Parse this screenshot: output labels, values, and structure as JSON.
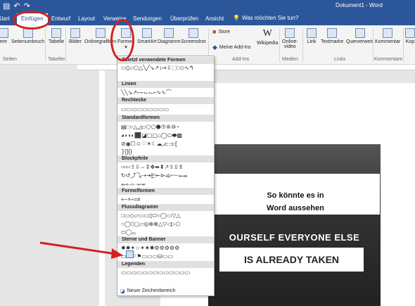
{
  "titlebar": {
    "title": "Dokument1 - Word",
    "undo": "↶",
    "redo": "↷",
    "save": "▤"
  },
  "tabs": [
    {
      "label": "Start"
    },
    {
      "label": "Einfügen"
    },
    {
      "label": "Entwurf"
    },
    {
      "label": "Layout"
    },
    {
      "label": "Verweise"
    },
    {
      "label": "Sendungen"
    },
    {
      "label": "Überprüfen"
    },
    {
      "label": "Ansicht"
    }
  ],
  "tellme": "Was möchten Sie tun?",
  "ribbon": {
    "buttons": {
      "seitenumbruch": "Seitenumbruch",
      "tabelle": "Tabelle",
      "bilder": "Bilder",
      "onlinegrafiken": "Onlinegrafiken",
      "formen": "Formen",
      "smartart": "SmartArt",
      "diagramm": "Diagramm",
      "screenshot": "Screenshot",
      "store": "Store",
      "meine_addins": "Meine Add-Ins",
      "wikipedia": "Wikipedia",
      "onlinevideo1": "Online-",
      "onlinevideo2": "video",
      "link": "Link",
      "textmarke": "Textmarke",
      "querverweis": "Querverweis",
      "kommentar": "Kommentar",
      "kopf": "Kop",
      "ere": "ere"
    },
    "groups": {
      "seiten": "Seiten",
      "tabellen": "Tabellen",
      "addins": "Add-Ins",
      "medien": "Medien",
      "links": "Links",
      "kommentare": "Kommentare"
    }
  },
  "shapes_menu": {
    "sections": [
      "Zuletzt verwendete Formen",
      "Linien",
      "Rechtecke",
      "Standardformen",
      "Blockpfeile",
      "Formelformen",
      "Flussdiagramm",
      "Sterne und Banner",
      "Legenden"
    ],
    "footer": "Neuer Zeichenbereich",
    "rows": {
      "recent": "▭▯▱⬠△╲╱↘↗↕⇒⇩⬚□◇∿↰",
      "lines": "╲╲↘↗⌐⌐⌙⌙⌐∿∿⌒",
      "rects": "▭▭▭▭▭▭▭▭▭",
      "std1": "▤□○△◿▱⬡⬠⬣⑦⑧⑩◔",
      "std2": "◕◗◖◐⬛◪▢▢⌂◯⬭⬬▩",
      "std3": "⊘◉☐☺♡☀☾☁◞⊏⊐⦃",
      "std4": "⦄[]{}",
      "blk1": "⇨⇦⇧⇩⇔⇕✥⬌⬍↗⇪⇫⇯",
      "blk2": "↻↺⤴⤵⇢⇥⬱⇜⊳⬲⬳⬴⬵",
      "blk3": "⬶⬷⬸⬹⬺",
      "formula": "+−×÷=≠",
      "flow1": "□▭◇▱▭▭▯⬭○◯▭▽△",
      "flow2": "○◯⬯▢▱◎⊕⊗△▽◁▷⬠",
      "flow3": "⬭◯⌓",
      "stars1": "✸✹✦☆✶✷✺⚙⚙⚙⚙⚙",
      "stars2": "▭▭⚐⚑▭▭▭⛁▭▭",
      "callouts": "▭▭▭▭▭▭▭▭▭▭▭▭▭"
    }
  },
  "document": {
    "banner_line1": "So könnte es in",
    "banner_line2": "Word aussehen",
    "photo_line1": "OURSELF EVERYONE ELSE",
    "photo_line2": "IS ALREADY TAKEN"
  },
  "colors": {
    "accent": "#2b579a",
    "highlight": "#d42020"
  }
}
